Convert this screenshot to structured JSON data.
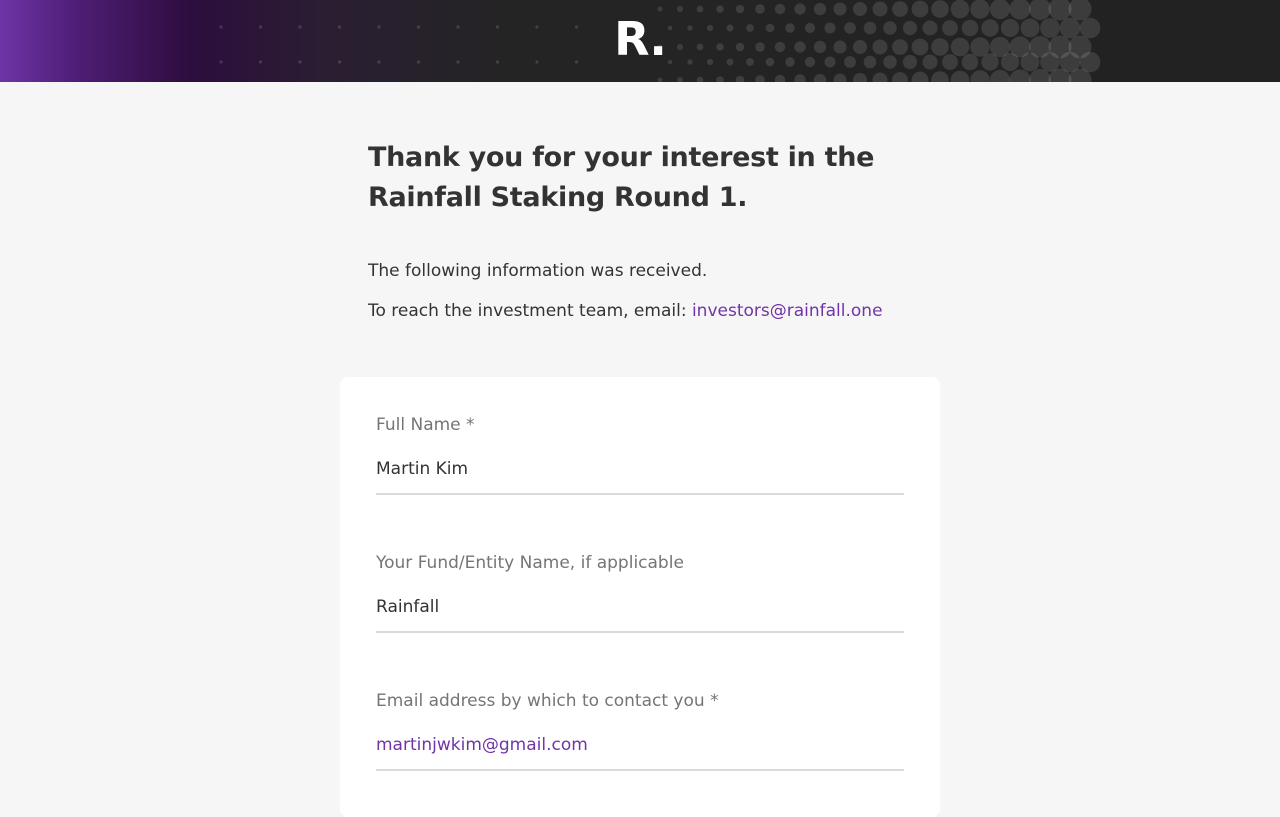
{
  "header": {
    "logo_text": "R."
  },
  "intro": {
    "title_line1": "Thank you for your interest in the",
    "title_line2": "Rainfall Staking Round 1.",
    "received_text": "The following information was received.",
    "contact_prefix": "To reach the investment team, email: ",
    "contact_email": "investors@rainfall.one"
  },
  "form": {
    "fields": [
      {
        "label": "Full Name *",
        "value": "Martin Kim"
      },
      {
        "label": "Your Fund/Entity Name, if applicable",
        "value": "Rainfall"
      },
      {
        "label": "Email address by which to contact you *",
        "value": "martinjwkim@gmail.com"
      }
    ]
  },
  "colors": {
    "accent": "#7134a8",
    "banner_purple": "#6e34a6",
    "banner_dark": "#222222",
    "page_background": "#f6f6f6",
    "card_background": "#ffffff"
  }
}
